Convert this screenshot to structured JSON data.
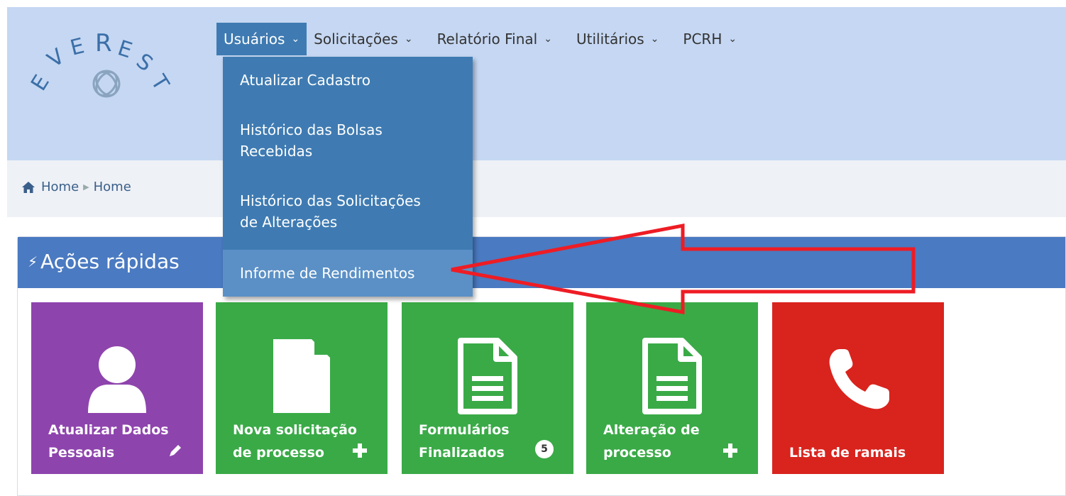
{
  "header": {
    "logo_text": "EVEREST",
    "nav": [
      {
        "label": "Usuários",
        "active": true
      },
      {
        "label": "Solicitações"
      },
      {
        "label": "Relatório Final"
      },
      {
        "label": "Utilitários"
      },
      {
        "label": "PCRH"
      }
    ]
  },
  "dropdown": {
    "items": [
      {
        "lines": [
          "Atualizar Cadastro"
        ]
      },
      {
        "lines": [
          "Histórico das Bolsas",
          "Recebidas"
        ]
      },
      {
        "lines": [
          "Histórico das Solicitações",
          "de Alterações"
        ]
      },
      {
        "lines": [
          "Informe de Rendimentos"
        ],
        "highlighted": true
      }
    ]
  },
  "breadcrumb": {
    "items": [
      "Home",
      "Home"
    ]
  },
  "panel": {
    "title": "Ações rápidas"
  },
  "tiles": [
    {
      "lines": [
        "Atualizar Dados",
        "Pessoais"
      ],
      "icon": "user-icon",
      "corner": "pencil-icon",
      "color": "#8e44ad"
    },
    {
      "lines": [
        "Nova solicitação",
        "de processo"
      ],
      "icon": "file-icon",
      "corner": "plus-icon",
      "color": "#3aaa47"
    },
    {
      "lines": [
        "Formulários",
        "Finalizados"
      ],
      "icon": "file-text-icon",
      "corner": "badge",
      "badge": "5",
      "color": "#3aaa47"
    },
    {
      "lines": [
        "Alteração de",
        "processo"
      ],
      "icon": "file-text-icon",
      "corner": "plus-icon",
      "color": "#3aaa47"
    },
    {
      "lines": [
        "Lista de ramais"
      ],
      "icon": "phone-icon",
      "color": "#d9231d"
    }
  ],
  "colors": {
    "header_bg": "#c5d7f2",
    "nav_active": "#3f7bb2",
    "panel_header": "#4a7ac1",
    "annotation_arrow": "#ee1c24"
  }
}
